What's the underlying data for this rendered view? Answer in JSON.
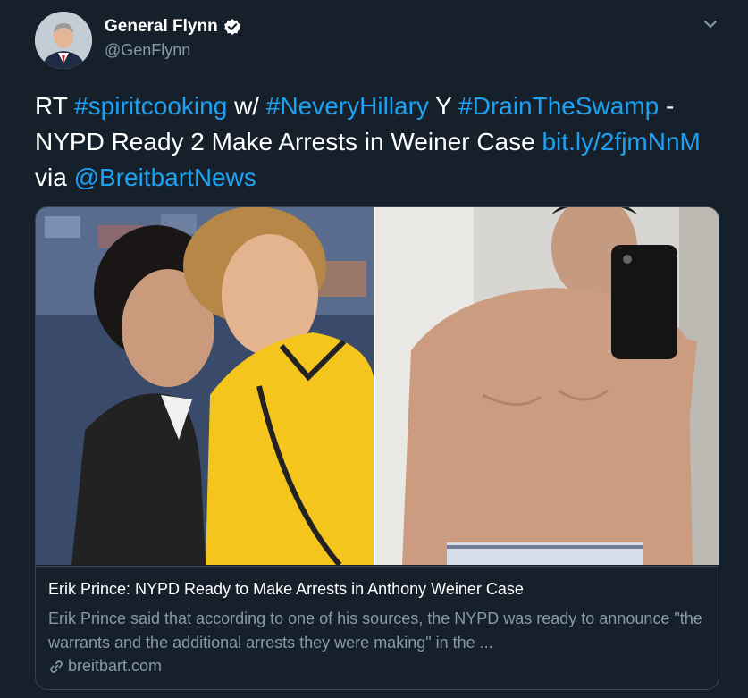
{
  "author": {
    "display_name": "General Flynn",
    "handle": "@GenFlynn",
    "verified_icon": "verified-badge-icon"
  },
  "tweet": {
    "parts": {
      "rt": "RT ",
      "hashtag1": "#spiritcooking",
      "w": " w/ ",
      "hashtag2": "#NeveryHillary",
      "y": " Y ",
      "hashtag3": "#DrainTheSwamp",
      "headline": " - NYPD Ready 2 Make Arrests in Weiner Case ",
      "link": "bit.ly/2fjmNnM",
      "via": " via ",
      "mention": "@BreitbartNews"
    }
  },
  "card": {
    "title": "Erik Prince: NYPD Ready to Make Arrests in Anthony Weiner Case",
    "description": "Erik Prince said that according to one of his sources, the NYPD was ready to announce \"the warrants and the additional arrests they were making\" in the ...",
    "domain": "breitbart.com"
  },
  "colors": {
    "background": "#15202b",
    "link": "#1da1f2",
    "secondary_text": "#8899a6",
    "border": "#38444d"
  }
}
